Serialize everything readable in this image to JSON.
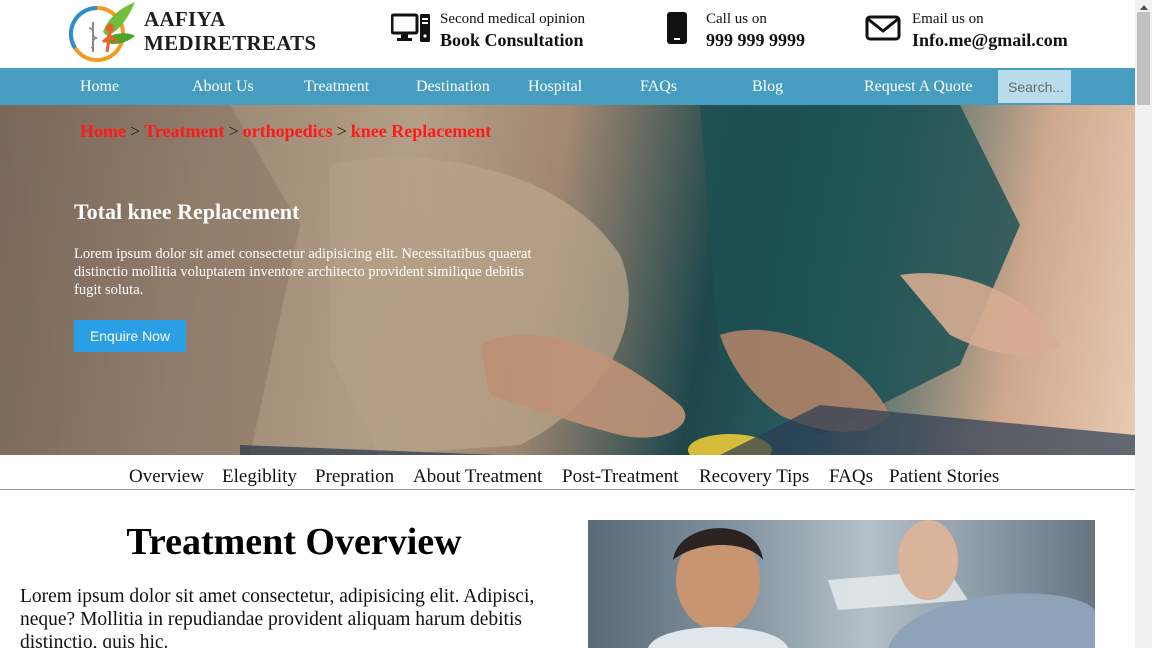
{
  "brand": {
    "line1": "AAFIYA",
    "line2": "MEDIRETREATS"
  },
  "contacts": [
    {
      "icon": "computer-icon",
      "small": "Second medical opinion",
      "big": "Book Consultation"
    },
    {
      "icon": "phone-icon",
      "small": "Call us on",
      "big": "999 999 9999"
    },
    {
      "icon": "envelope-icon",
      "small": "Email us on",
      "big": "Info.me@gmail.com"
    }
  ],
  "nav": {
    "items": [
      "Home",
      "About Us",
      "Treatment",
      "Destination",
      "Hospital",
      "FAQs",
      "Blog",
      "Request A Quote"
    ],
    "search_placeholder": "Search..."
  },
  "breadcrumb": [
    "Home",
    "Treatment",
    "orthopedics",
    "knee Replacement"
  ],
  "breadcrumb_separator": ">",
  "hero": {
    "title": "Total knee Replacement",
    "text": "Lorem ipsum dolor sit amet consectetur adipisicing elit. Necessitatibus quaerat distinctio mollitia voluptatem inventore architecto provident similique debitis fugit soluta.",
    "button": "Enquire Now"
  },
  "subtabs": [
    "Overview",
    "Elegiblity",
    "Prepration",
    "About Treatment",
    "Post-Treatment",
    "Recovery Tips",
    "FAQs",
    "Patient Stories"
  ],
  "overview": {
    "title": "Treatment Overview",
    "text": "Lorem ipsum dolor sit amet consectetur, adipisicing elit. Adipisci, neque? Mollitia in repudiandae provident aliquam harum debitis distinctio, quis hic."
  },
  "colors": {
    "nav_bg": "#479dbf",
    "breadcrumb_link": "#ff1a1a",
    "button_bg": "#2a9fe6"
  }
}
